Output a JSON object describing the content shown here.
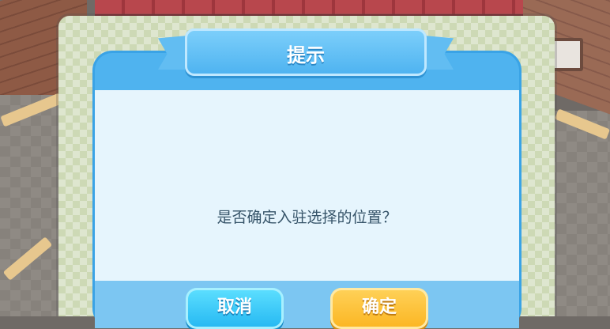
{
  "dialog": {
    "title": "提示",
    "message": "是否确定入驻选择的位置？",
    "cancel_label": "取消",
    "confirm_label": "确定"
  },
  "colors": {
    "accent_blue": "#4fb3ef",
    "body_bg": "#e6f5fd",
    "cancel_button": "#24b7f2",
    "confirm_button": "#fbb521",
    "message_text": "#365469"
  }
}
